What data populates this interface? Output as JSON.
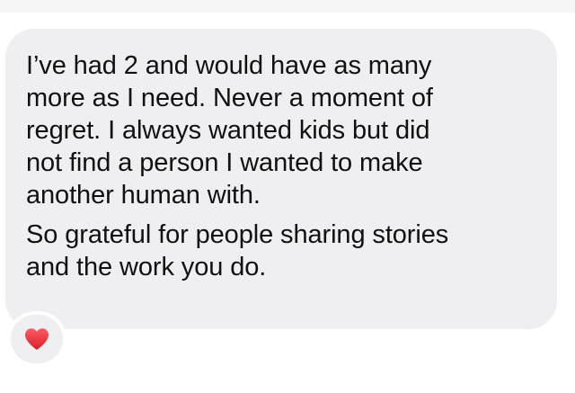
{
  "message": {
    "paragraph_1": [
      "I’ve had 2 and would have as many",
      "more as I need. Never a moment of",
      "regret. I always wanted kids but did",
      "not find a person I wanted to make",
      "another human with."
    ],
    "paragraph_2": [
      "So grateful for people sharing stories",
      "and the work you do."
    ]
  },
  "reaction": {
    "icon": "heart-icon",
    "color": "#e0303b"
  }
}
